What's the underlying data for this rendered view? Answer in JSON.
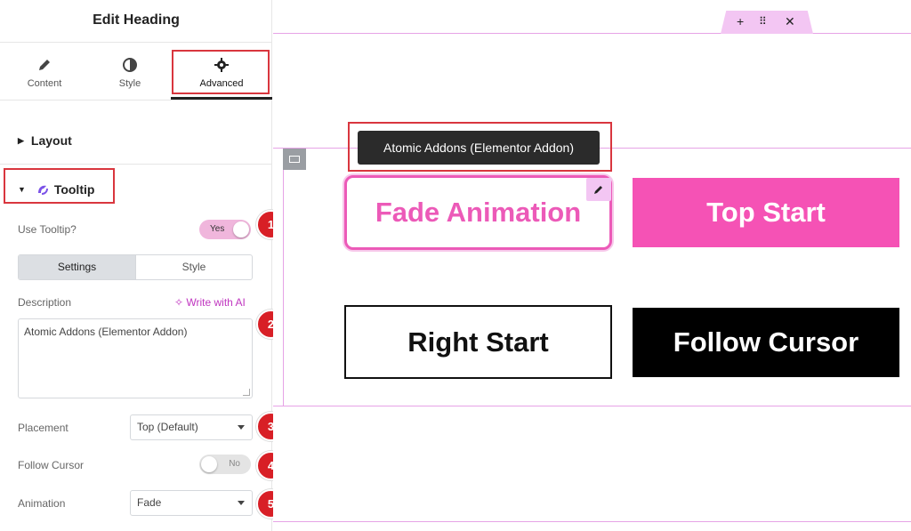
{
  "panel": {
    "title": "Edit Heading",
    "tabs": [
      {
        "label": "Content",
        "icon": "pencil-icon"
      },
      {
        "label": "Style",
        "icon": "contrast-icon"
      },
      {
        "label": "Advanced",
        "icon": "gear-icon",
        "active": true
      }
    ],
    "layout_section": "Layout",
    "tooltip_section": "Tooltip",
    "use_tooltip": {
      "label": "Use Tooltip?",
      "value": "Yes"
    },
    "subtabs": [
      {
        "label": "Settings",
        "active": true
      },
      {
        "label": "Style"
      }
    ],
    "description": {
      "label": "Description",
      "ai_link": "Write with AI",
      "value": "Atomic Addons (Elementor Addon)"
    },
    "placement": {
      "label": "Placement",
      "value": "Top (Default)"
    },
    "follow_cursor": {
      "label": "Follow Cursor",
      "value": "No"
    },
    "animation": {
      "label": "Animation",
      "value": "Fade"
    },
    "badges": [
      "1",
      "2",
      "3",
      "4",
      "5"
    ]
  },
  "canvas": {
    "tooltip_text": "Atomic Addons (Elementor Addon)",
    "buttons": [
      "Fade Animation",
      "Top Start",
      "Right Start",
      "Follow Cursor"
    ],
    "handle_icons": [
      "plus-icon",
      "grip-icon",
      "close-icon"
    ]
  },
  "colors": {
    "accent_pink": "#ec5ab8",
    "badge_red": "#d81f26",
    "highlight_red": "#d9363e"
  }
}
